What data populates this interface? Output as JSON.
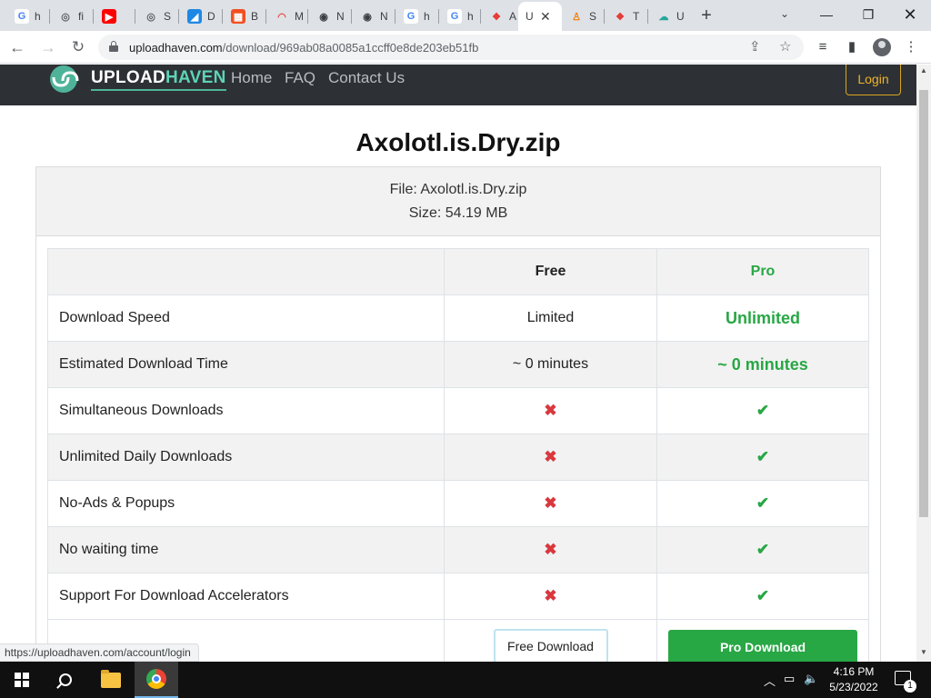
{
  "browser": {
    "tabs": [
      {
        "letter": "G",
        "title": "h",
        "color": "#ffffff",
        "fg": "#4285f4"
      },
      {
        "letter": "◎",
        "title": "fi",
        "color": "#dee1e6",
        "fg": "#5f6368"
      },
      {
        "letter": "▶",
        "title": "",
        "color": "#ff0000",
        "fg": "#ffffff"
      },
      {
        "letter": "◎",
        "title": "S",
        "color": "#dee1e6",
        "fg": "#5f6368"
      },
      {
        "letter": "◢",
        "title": "D",
        "color": "#1e88e5",
        "fg": "#ffffff"
      },
      {
        "letter": "▦",
        "title": "B",
        "color": "#f25022",
        "fg": "#ffffff"
      },
      {
        "letter": "◠",
        "title": "M",
        "color": "#dee1e6",
        "fg": "#e8453c"
      },
      {
        "letter": "◉",
        "title": "N",
        "color": "#dee1e6",
        "fg": "#3c4043"
      },
      {
        "letter": "◉",
        "title": "N",
        "color": "#dee1e6",
        "fg": "#3c4043"
      },
      {
        "letter": "G",
        "title": "h",
        "color": "#ffffff",
        "fg": "#4285f4"
      },
      {
        "letter": "G",
        "title": "h",
        "color": "#ffffff",
        "fg": "#4285f4"
      },
      {
        "letter": "❖",
        "title": "A",
        "color": "#dee1e6",
        "fg": "#e53935"
      },
      {
        "letter": "U",
        "title": "",
        "color": "#ffffff",
        "fg": "#3c4043"
      },
      {
        "letter": "♙",
        "title": "S",
        "color": "#dee1e6",
        "fg": "#f57c00"
      },
      {
        "letter": "❖",
        "title": "T",
        "color": "#dee1e6",
        "fg": "#e53935"
      },
      {
        "letter": "☁",
        "title": "U",
        "color": "#dee1e6",
        "fg": "#26a69a"
      }
    ],
    "active_tab_title": "U",
    "url_host": "uploadhaven.com",
    "url_path": "/download/969ab08a0085a1ccff0e8de203eb51fb",
    "status_url": "https://uploadhaven.com/account/login"
  },
  "site": {
    "logo_upload": "UPLOAD",
    "logo_haven": "HAVEN",
    "nav": {
      "home": "Home",
      "faq": "FAQ",
      "contact": "Contact Us"
    },
    "login": "Login"
  },
  "file": {
    "title": "Axolotl.is.Dry.zip",
    "file_line": "File: Axolotl.is.Dry.zip",
    "size_line": "Size: 54.19 MB"
  },
  "compare": {
    "header": {
      "free": "Free",
      "pro": "Pro"
    },
    "rows": [
      {
        "label": "Download Speed",
        "free": "Limited",
        "pro": "Unlimited"
      },
      {
        "label": "Estimated Download Time",
        "free": "~ 0 minutes",
        "pro": "~ 0 minutes"
      },
      {
        "label": "Simultaneous Downloads",
        "free": "✖",
        "pro": "✔"
      },
      {
        "label": "Unlimited Daily Downloads",
        "free": "✖",
        "pro": "✔"
      },
      {
        "label": "No-Ads & Popups",
        "free": "✖",
        "pro": "✔"
      },
      {
        "label": "No waiting time",
        "free": "✖",
        "pro": "✔"
      },
      {
        "label": "Support For Download Accelerators",
        "free": "✖",
        "pro": "✔"
      }
    ],
    "free_button": "Free Download",
    "pro_button": "Pro Download"
  },
  "taskbar": {
    "time": "4:16 PM",
    "date": "5/23/2022",
    "notification_count": "1"
  },
  "colors": {
    "accent_green": "#28a745",
    "nav_bg": "#2d3136",
    "login_border": "#d9a520",
    "cross_red": "#d9383e"
  }
}
